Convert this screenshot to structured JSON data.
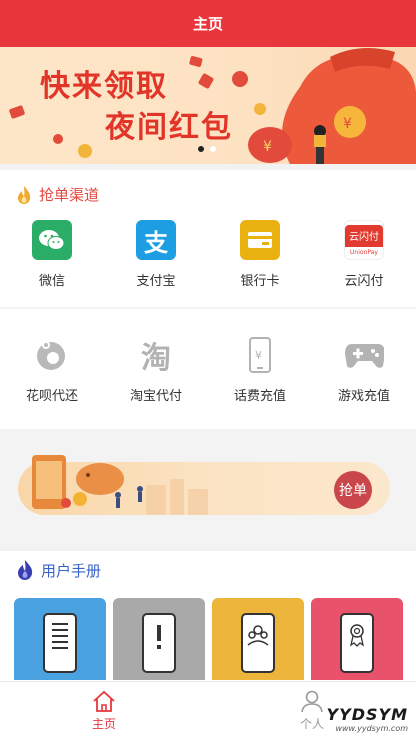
{
  "header": {
    "title": "主页"
  },
  "banner": {
    "line1": "快来领取",
    "line2": "夜间红包"
  },
  "channels": {
    "title": "抢单渠道",
    "row1": [
      {
        "label": "微信",
        "icon": "wechat-icon",
        "color": "#2aae67"
      },
      {
        "label": "支付宝",
        "icon": "alipay-icon",
        "color": "#1d9ee3"
      },
      {
        "label": "银行卡",
        "icon": "bank-card-icon",
        "color": "#e9b210"
      },
      {
        "label": "云闪付",
        "icon": "unionpay-icon",
        "color": "#e23a2e"
      }
    ],
    "row2": [
      {
        "label": "花呗代还",
        "icon": "huabei-icon"
      },
      {
        "label": "淘宝代付",
        "icon": "taobao-icon"
      },
      {
        "label": "话费充值",
        "icon": "phone-recharge-icon"
      },
      {
        "label": "游戏充值",
        "icon": "gamepad-icon"
      }
    ]
  },
  "promo": {
    "button": "抢单"
  },
  "manual": {
    "title": "用户手册",
    "cards": [
      {
        "icon": "document-icon",
        "color": "#4aa3e0"
      },
      {
        "icon": "exclamation-icon",
        "color": "#a9a9a9"
      },
      {
        "icon": "users-icon",
        "color": "#edb53c"
      },
      {
        "icon": "certificate-icon",
        "color": "#e8526a"
      }
    ]
  },
  "tabbar": {
    "home": "主页",
    "profile": "个人",
    "active_color": "#e8363d",
    "inactive_color": "#999999"
  },
  "watermark": {
    "main": "YYDSYM",
    "sub": "www.yydsym.com"
  }
}
